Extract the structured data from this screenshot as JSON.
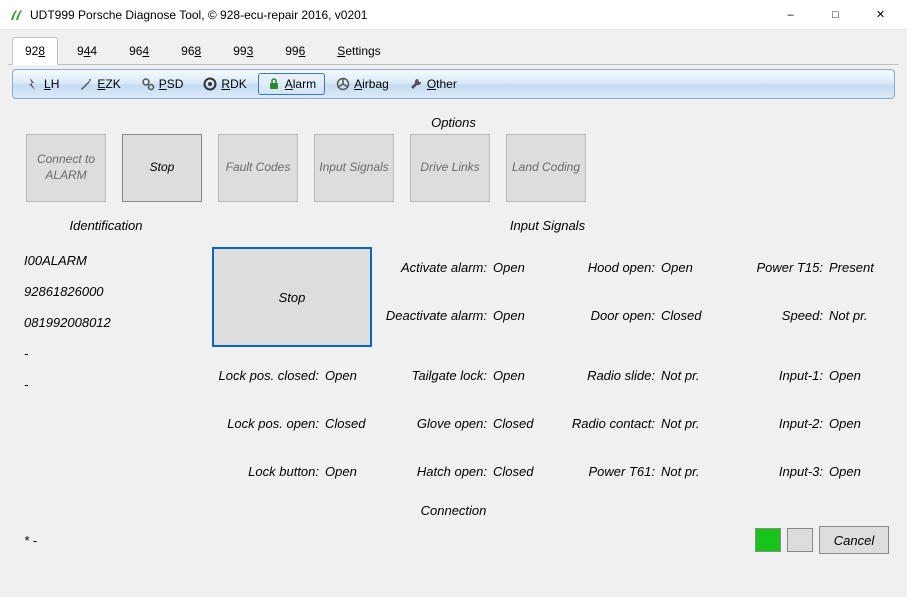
{
  "window": {
    "title": "UDT999 Porsche Diagnose Tool, © 928-ecu-repair 2016, v0201"
  },
  "model_tabs": [
    {
      "pre": "92",
      "u": "8",
      "post": "",
      "active": true
    },
    {
      "pre": "9",
      "u": "4",
      "post": "4",
      "active": false
    },
    {
      "pre": "96",
      "u": "4",
      "post": "",
      "active": false
    },
    {
      "pre": "96",
      "u": "8",
      "post": "",
      "active": false
    },
    {
      "pre": "99",
      "u": "3",
      "post": "",
      "active": false
    },
    {
      "pre": "99",
      "u": "6",
      "post": "",
      "active": false
    },
    {
      "pre": "",
      "u": "S",
      "post": "ettings",
      "active": false
    }
  ],
  "toolbar": [
    {
      "u": "L",
      "rest": "H",
      "icon": "spark",
      "active": false
    },
    {
      "u": "E",
      "rest": "ZK",
      "icon": "wand",
      "active": false
    },
    {
      "u": "P",
      "rest": "SD",
      "icon": "gears",
      "active": false
    },
    {
      "u": "R",
      "rest": "DK",
      "icon": "tire",
      "active": false
    },
    {
      "u": "A",
      "rest": "larm",
      "icon": "lock",
      "active": true
    },
    {
      "u": "A",
      "rest": "irbag",
      "icon": "wheel",
      "active": false
    },
    {
      "u": "O",
      "rest": "ther",
      "icon": "wrench",
      "active": false
    }
  ],
  "options": {
    "title": "Options",
    "buttons": [
      {
        "label": "Connect to ALARM",
        "enabled": false
      },
      {
        "label": "Stop",
        "enabled": true
      },
      {
        "label": "Fault Codes",
        "enabled": false
      },
      {
        "label": "Input Signals",
        "enabled": false
      },
      {
        "label": "Drive Links",
        "enabled": false
      },
      {
        "label": "Land Coding",
        "enabled": false
      }
    ]
  },
  "identification": {
    "title": "Identification",
    "lines": [
      "I00ALARM",
      "92861826000",
      "081992008012",
      "-",
      "-"
    ]
  },
  "input_signals": {
    "title": "Input Signals",
    "stop_label": "Stop",
    "grid": [
      [
        null,
        {
          "label": "Activate alarm:",
          "value": "Open"
        },
        {
          "label": "Hood open:",
          "value": "Open"
        },
        {
          "label": "Power T15:",
          "value": "Present"
        }
      ],
      [
        null,
        {
          "label": "Deactivate alarm:",
          "value": "Open"
        },
        {
          "label": "Door open:",
          "value": "Closed"
        },
        {
          "label": "Speed:",
          "value": "Not pr."
        }
      ],
      [
        {
          "label": "Lock pos. closed:",
          "value": "Open"
        },
        {
          "label": "Tailgate lock:",
          "value": "Open"
        },
        {
          "label": "Radio slide:",
          "value": "Not pr."
        },
        {
          "label": "Input-1:",
          "value": "Open"
        }
      ],
      [
        {
          "label": "Lock pos. open:",
          "value": "Closed"
        },
        {
          "label": "Glove open:",
          "value": "Closed"
        },
        {
          "label": "Radio contact:",
          "value": "Not pr."
        },
        {
          "label": "Input-2:",
          "value": "Open"
        }
      ],
      [
        {
          "label": "Lock button:",
          "value": "Open"
        },
        {
          "label": "Hatch open:",
          "value": "Closed"
        },
        {
          "label": "Power T61:",
          "value": "Not pr."
        },
        {
          "label": "Input-3:",
          "value": "Open"
        }
      ]
    ]
  },
  "connection": {
    "title": "Connection",
    "status": "*  -",
    "cancel": "Cancel"
  }
}
